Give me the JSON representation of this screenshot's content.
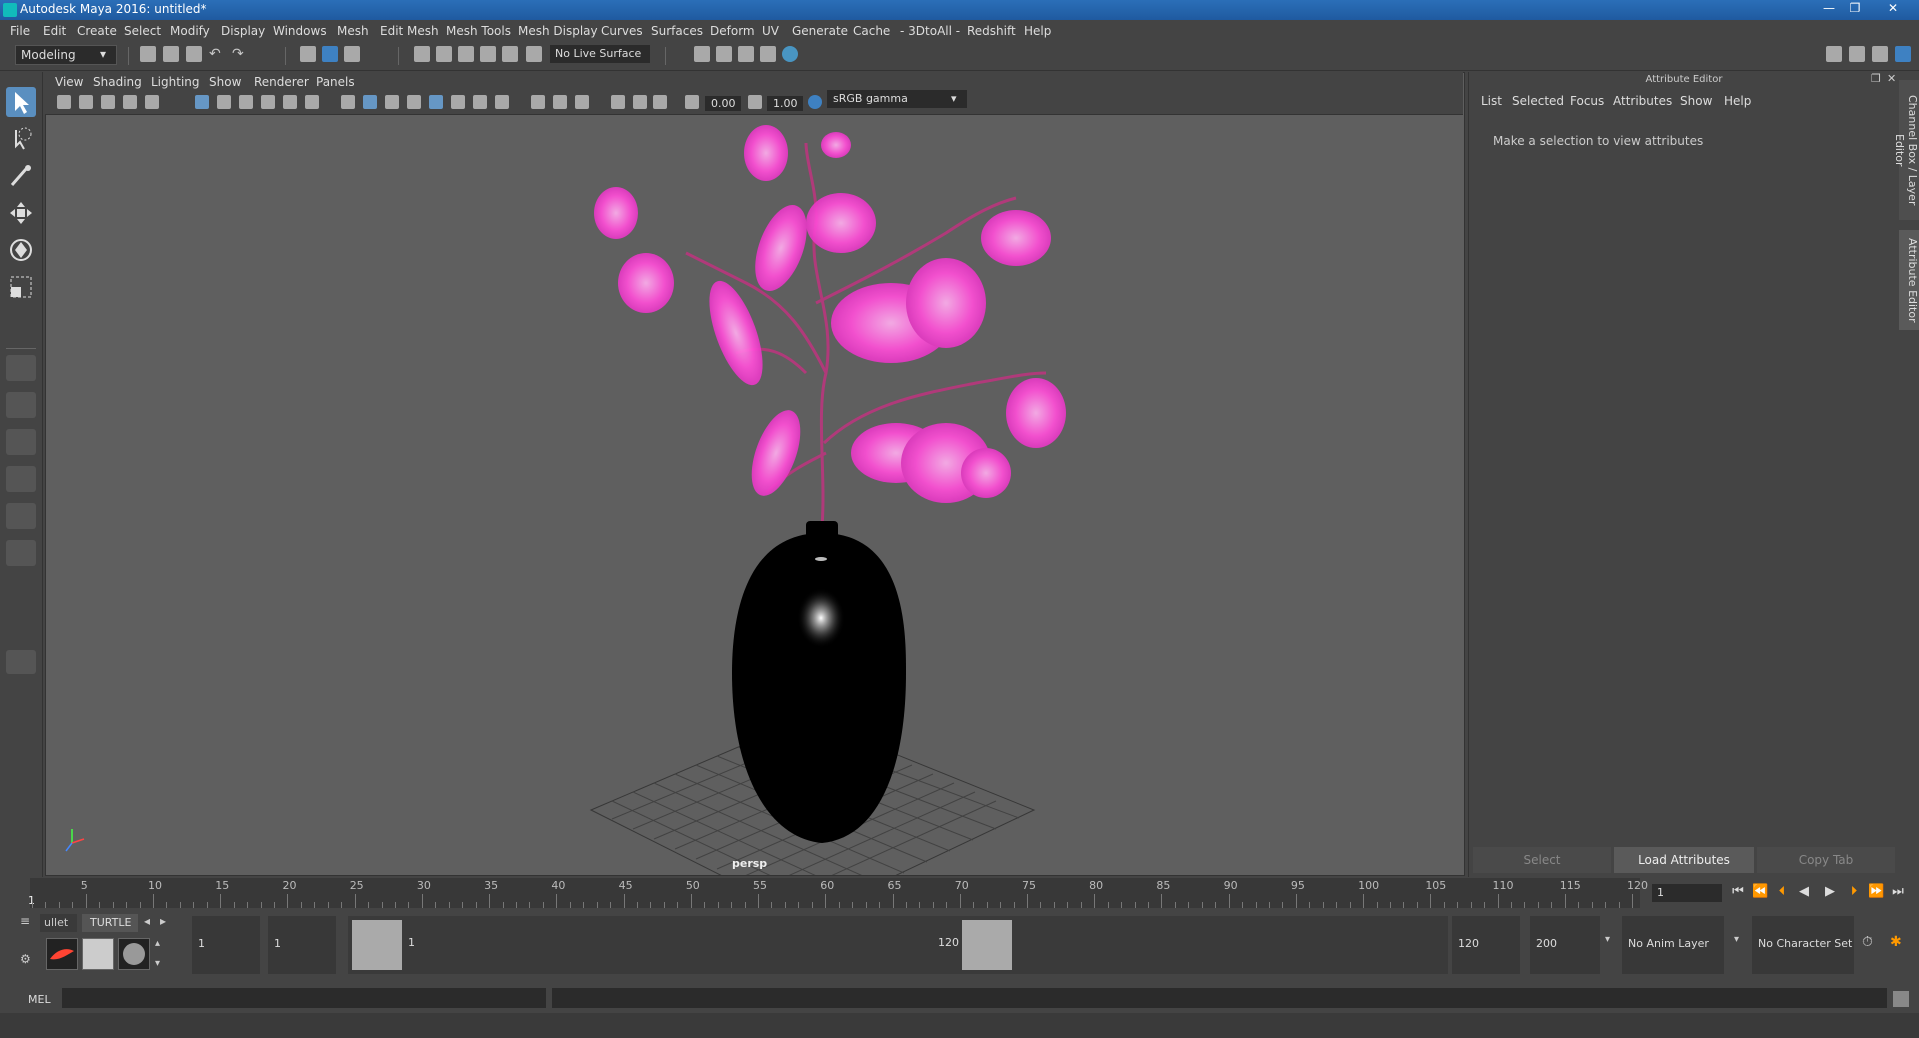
{
  "window": {
    "title": "Autodesk Maya 2016: untitled*"
  },
  "menu": [
    "File",
    "Edit",
    "Create",
    "Select",
    "Modify",
    "Display",
    "Windows",
    "Mesh",
    "Edit Mesh",
    "Mesh Tools",
    "Mesh Display",
    "Curves",
    "Surfaces",
    "Deform",
    "UV",
    "Generate",
    "Cache",
    "- 3DtoAll -",
    "Redshift",
    "Help"
  ],
  "toolbar": {
    "mode": "Modeling",
    "live_surface": "No Live Surface"
  },
  "viewport": {
    "menu": [
      "View",
      "Shading",
      "Lighting",
      "Show",
      "Renderer",
      "Panels"
    ],
    "exposure": "0.00",
    "gamma": "1.00",
    "color_space": "sRGB gamma",
    "camera_label": "persp"
  },
  "attribute_editor": {
    "header": "Attribute Editor",
    "menu": [
      "List",
      "Selected",
      "Focus",
      "Attributes",
      "Show",
      "Help"
    ],
    "message": "Make a selection to view attributes",
    "buttons": {
      "select": "Select",
      "load": "Load Attributes",
      "copy": "Copy Tab"
    }
  },
  "side_tabs": {
    "channel_box": "Channel Box / Layer Editor",
    "attribute_editor": "Attribute Editor"
  },
  "timeline": {
    "ticks": [
      "5",
      "10",
      "15",
      "20",
      "25",
      "30",
      "35",
      "40",
      "45",
      "50",
      "55",
      "60",
      "65",
      "70",
      "75",
      "80",
      "85",
      "90",
      "95",
      "100",
      "105",
      "110",
      "115",
      "120"
    ],
    "start_marker": "1",
    "current_frame": "1"
  },
  "range": {
    "shelf_tabs": [
      "ullet",
      "TURTLE"
    ],
    "start": "1",
    "playback_start": "1",
    "range_start_label": "1",
    "range_end_label": "120",
    "playback_end": "120",
    "end": "200",
    "anim_layer": "No Anim Layer",
    "character_set": "No Character Set"
  },
  "command": {
    "lang": "MEL"
  },
  "colors": {
    "flower": "#ff4fd8",
    "vase": "#000000",
    "viewport_bg": "#5f5f5f",
    "accent": "#1bb"
  }
}
